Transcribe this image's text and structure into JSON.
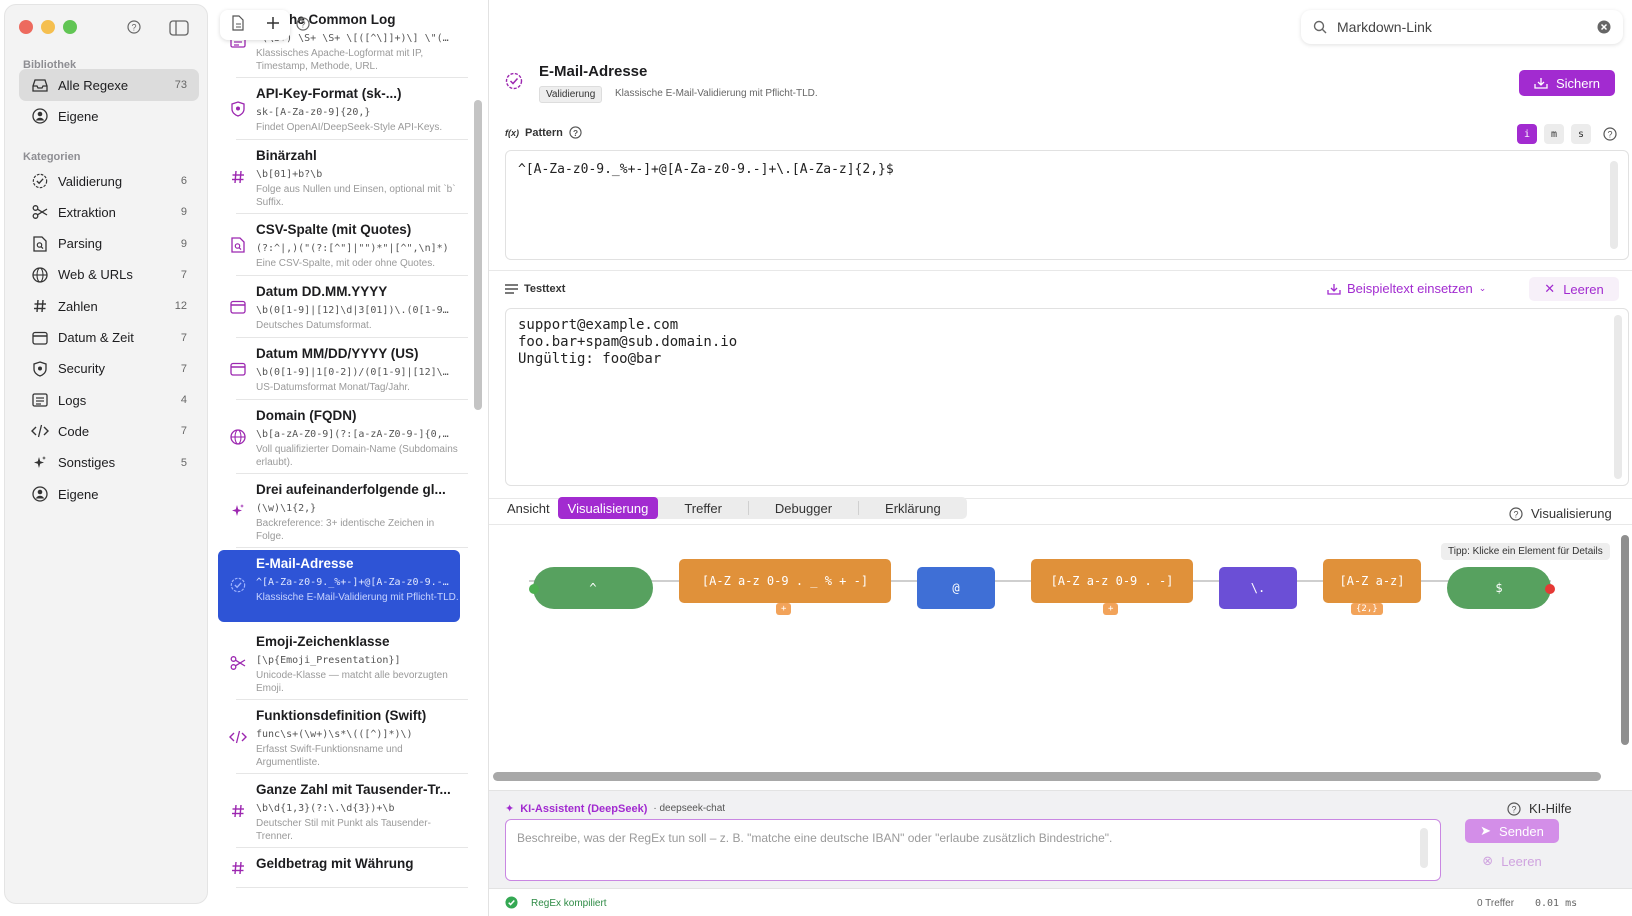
{
  "sidebar": {
    "library_title": "Bibliothek",
    "library_items": [
      {
        "label": "Alle Regexe",
        "count": "73",
        "icon": "tray-icon",
        "active": true
      },
      {
        "label": "Eigene",
        "count": "",
        "icon": "person-icon",
        "active": false
      }
    ],
    "categories_title": "Kategorien",
    "categories": [
      {
        "label": "Validierung",
        "count": "6",
        "icon": "seal-check-icon"
      },
      {
        "label": "Extraktion",
        "count": "9",
        "icon": "scissors-icon"
      },
      {
        "label": "Parsing",
        "count": "9",
        "icon": "document-search-icon"
      },
      {
        "label": "Web & URLs",
        "count": "7",
        "icon": "globe-icon"
      },
      {
        "label": "Zahlen",
        "count": "12",
        "icon": "hash-icon"
      },
      {
        "label": "Datum & Zeit",
        "count": "7",
        "icon": "calendar-icon"
      },
      {
        "label": "Security",
        "count": "7",
        "icon": "shield-icon"
      },
      {
        "label": "Logs",
        "count": "4",
        "icon": "list-icon"
      },
      {
        "label": "Code",
        "count": "7",
        "icon": "code-icon"
      },
      {
        "label": "Sonstiges",
        "count": "5",
        "icon": "sparkles-icon"
      },
      {
        "label": "Eigene",
        "count": "",
        "icon": "person-icon"
      }
    ]
  },
  "list": {
    "items": [
      {
        "title": "Apache Common Log",
        "pattern": "^(\\S+) \\S+ \\S+ \\[([^\\]]+)\\] \\\"(…",
        "desc": "Klassisches Apache-Logformat mit IP, Timestamp, Methode, URL.",
        "icon": "list-icon"
      },
      {
        "title": "API-Key-Format (sk-...)",
        "pattern": "sk-[A-Za-z0-9]{20,}",
        "desc": "Findet OpenAI/DeepSeek-Style API-Keys.",
        "icon": "shield-icon"
      },
      {
        "title": "Binärzahl",
        "pattern": "\\b[01]+b?\\b",
        "desc": "Folge aus Nullen und Einsen, optional mit `b` Suffix.",
        "icon": "hash-icon"
      },
      {
        "title": "CSV-Spalte (mit Quotes)",
        "pattern": "(?:^|,)(\"(?:[^\"]|\"\")*\"|[^\",\\n]*)",
        "desc": "Eine CSV-Spalte, mit oder ohne Quotes.",
        "icon": "document-search-icon"
      },
      {
        "title": "Datum DD.MM.YYYY",
        "pattern": "\\b(0[1-9]|[12]\\d|3[01])\\.(0[1-9…",
        "desc": "Deutsches Datumsformat.",
        "icon": "calendar-icon"
      },
      {
        "title": "Datum MM/DD/YYYY (US)",
        "pattern": "\\b(0[1-9]|1[0-2])/(0[1-9]|[12]\\…",
        "desc": "US-Datumsformat Monat/Tag/Jahr.",
        "icon": "calendar-icon"
      },
      {
        "title": "Domain (FQDN)",
        "pattern": "\\b[a-zA-Z0-9](?:[a-zA-Z0-9-]{0,…",
        "desc": "Voll qualifizierter Domain-Name (Subdomains erlaubt).",
        "icon": "globe-icon"
      },
      {
        "title": "Drei aufeinanderfolgende gl...",
        "pattern": "(\\w)\\1{2,}",
        "desc": "Backreference: 3+ identische Zeichen in Folge.",
        "icon": "sparkles-icon"
      },
      {
        "title": "E-Mail-Adresse",
        "pattern": "^[A-Za-z0-9._%+-]+@[A-Za-z0-9.-…",
        "desc": "Klassische E-Mail-Validierung mit Pflicht-TLD.",
        "icon": "seal-check-icon",
        "selected": true
      },
      {
        "title": "Emoji-Zeichenklasse",
        "pattern": "[\\p{Emoji_Presentation}]",
        "desc": "Unicode-Klasse — matcht alle bevorzugten Emoji.",
        "icon": "scissors-icon"
      },
      {
        "title": "Funktionsdefinition (Swift)",
        "pattern": "func\\s+(\\w+)\\s*\\(([^)]*)\\)",
        "desc": "Erfasst Swift-Funktionsname und Argumentliste.",
        "icon": "code-icon"
      },
      {
        "title": "Ganze Zahl mit Tausender-Tr...",
        "pattern": "\\b\\d{1,3}(?:\\.\\d{3})+\\b",
        "desc": "Deutscher Stil mit Punkt als Tausender-Trenner.",
        "icon": "hash-icon"
      },
      {
        "title": "Geldbetrag mit Währung",
        "pattern": "",
        "desc": "",
        "icon": "hash-icon"
      }
    ]
  },
  "search": {
    "value": "Markdown-Link"
  },
  "detail": {
    "title": "E-Mail-Adresse",
    "badge": "Validierung",
    "subtitle": "Klassische E-Mail-Validierung mit Pflicht-TLD.",
    "save_label": "Sichern",
    "pattern_label": "Pattern",
    "pattern_prefix": "f(x)",
    "flags": [
      "i",
      "m",
      "s"
    ],
    "pattern": "^[A-Za-z0-9._%+-]+@[A-Za-z0-9.-]+\\.[A-Za-z]{2,}$",
    "testtext_label": "Testtext",
    "insert_sample_label": "Beispieltext einsetzen",
    "clear_label": "Leeren",
    "testtext": "support@example.com\nfoo.bar+spam@sub.domain.io\nUngültig: foo@bar"
  },
  "view": {
    "label": "Ansicht",
    "tabs": [
      "Visualisierung",
      "Treffer",
      "Debugger",
      "Erklärung"
    ],
    "active_tab": "Visualisierung",
    "right_label": "Visualisierung",
    "tip": "Tipp: Klicke ein Element für Details",
    "nodes": [
      {
        "text": "^",
        "color": "#57a15f"
      },
      {
        "text": "[A-Z a-z 0-9 . _ % + -]",
        "color": "#e0913a",
        "quant": "+"
      },
      {
        "text": "@",
        "color": "#3f6fd6"
      },
      {
        "text": "[A-Z a-z 0-9 . -]",
        "color": "#e0913a",
        "quant": "+"
      },
      {
        "text": "\\.",
        "color": "#6b4fd6"
      },
      {
        "text": "[A-Z a-z]",
        "color": "#e0913a",
        "quant": "{2,}"
      },
      {
        "text": "$",
        "color": "#57a15f"
      }
    ]
  },
  "ai": {
    "title": "KI-Assistent (DeepSeek)",
    "model": "· deepseek-chat",
    "help_label": "KI-Hilfe",
    "placeholder": "Beschreibe, was der RegEx tun soll – z. B. \"matche eine deutsche IBAN\" oder \"erlaube zusätzlich Bindestriche\".",
    "send_label": "Senden",
    "clear_label": "Leeren"
  },
  "status": {
    "compiled": "RegEx kompiliert",
    "matches": "0 Treffer",
    "time": "0.01 ms"
  },
  "colors": {
    "accent": "#a22bd0",
    "selection": "#2e54d6",
    "success": "#34a853"
  }
}
